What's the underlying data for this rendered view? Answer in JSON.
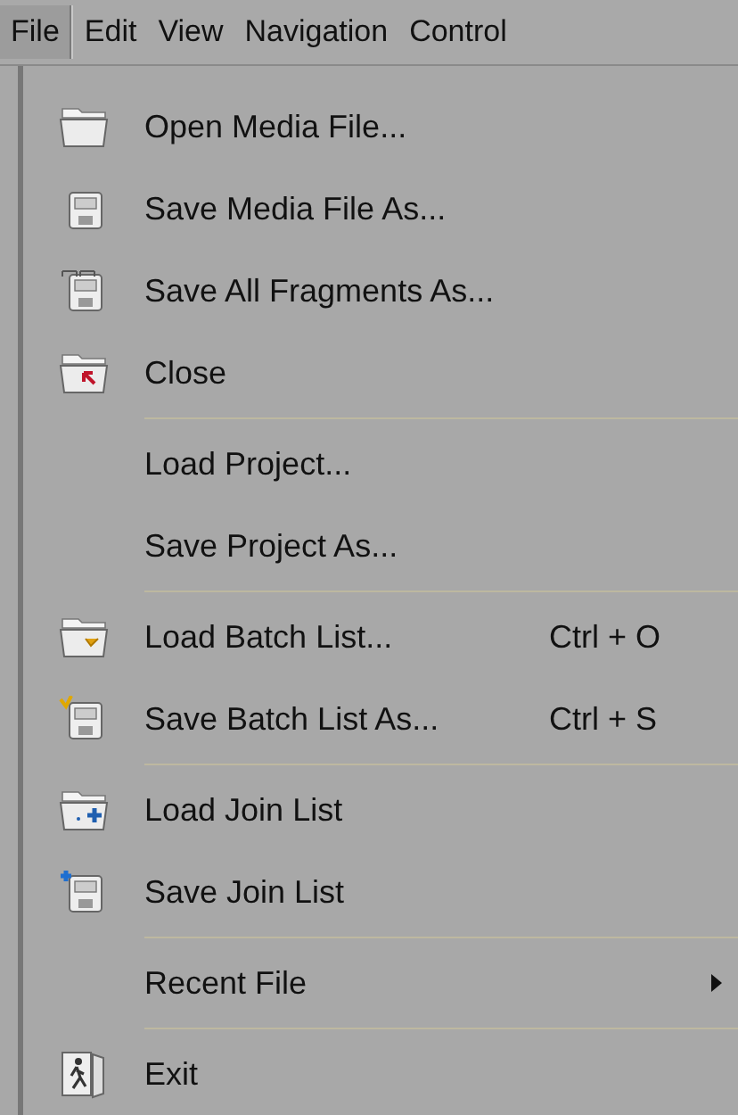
{
  "menu_bar": [
    {
      "label": "File",
      "selected": true
    },
    {
      "label": "Edit",
      "selected": false
    },
    {
      "label": "View",
      "selected": false
    },
    {
      "label": "Navigation",
      "selected": false
    },
    {
      "label": "Control",
      "selected": false
    }
  ],
  "file_menu": [
    {
      "kind": "item",
      "label": "Open Media File..."
    },
    {
      "kind": "item",
      "label": "Save Media File As..."
    },
    {
      "kind": "item",
      "label": "Save All Fragments As..."
    },
    {
      "kind": "item",
      "label": "Close"
    },
    {
      "kind": "separator"
    },
    {
      "kind": "item",
      "label": "Load Project..."
    },
    {
      "kind": "item",
      "label": "Save Project As..."
    },
    {
      "kind": "separator"
    },
    {
      "kind": "item",
      "label": "Load Batch List...",
      "shortcut": "Ctrl + O"
    },
    {
      "kind": "item",
      "label": "Save Batch List As...",
      "shortcut": "Ctrl + S"
    },
    {
      "kind": "separator"
    },
    {
      "kind": "item",
      "label": "Load Join List"
    },
    {
      "kind": "item",
      "label": "Save Join List"
    },
    {
      "kind": "separator"
    },
    {
      "kind": "item",
      "label": "Recent File",
      "submenu": true
    },
    {
      "kind": "separator"
    },
    {
      "kind": "item",
      "label": "Exit"
    }
  ]
}
